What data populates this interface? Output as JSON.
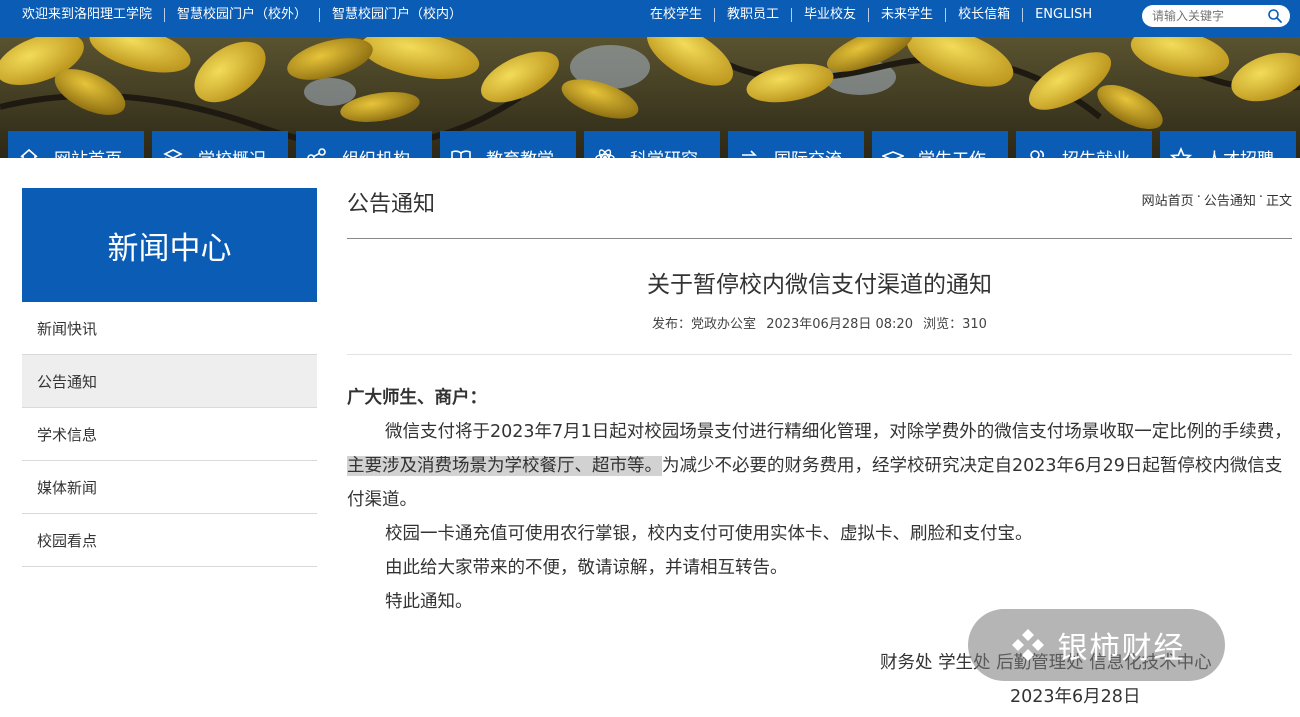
{
  "topbar": {
    "left_links": [
      "欢迎来到洛阳理工学院",
      "智慧校园门户（校外）",
      "智慧校园门户（校内）"
    ],
    "right_links": [
      "在校学生",
      "教职员工",
      "毕业校友",
      "未来学生",
      "校长信箱",
      "ENGLISH"
    ],
    "search_placeholder": "请输入关键字"
  },
  "nav": [
    {
      "label": "网站首页",
      "icon": "home-icon"
    },
    {
      "label": "学校概况",
      "icon": "layers-icon"
    },
    {
      "label": "组织机构",
      "icon": "share-icon"
    },
    {
      "label": "教育教学",
      "icon": "book-icon"
    },
    {
      "label": "科学研究",
      "icon": "atom-icon"
    },
    {
      "label": "国际交流",
      "icon": "exchange-icon"
    },
    {
      "label": "学生工作",
      "icon": "graduation-cap-icon"
    },
    {
      "label": "招生就业",
      "icon": "users-icon"
    },
    {
      "label": "人才招聘",
      "icon": "star-icon"
    }
  ],
  "sidebar": {
    "title": "新闻中心",
    "items": [
      "新闻快讯",
      "公告通知",
      "学术信息",
      "媒体新闻",
      "校园看点"
    ],
    "active_index": 1
  },
  "section_title": "公告通知",
  "breadcrumb": {
    "items": [
      "网站首页",
      "公告通知",
      "正文"
    ],
    "separator": "·"
  },
  "article": {
    "title": "关于暂停校内微信支付渠道的通知",
    "meta": {
      "publisher": "发布：党政办公室",
      "datetime": "2023年06月28日 08:20",
      "views": "浏览：310"
    },
    "greeting": "广大师生、商户：",
    "p1_a": "微信支付将于2023年7月1日起对校园场景支付进行精细化管理，对除学费外的微信支付场景收取一定比例的手续费，",
    "p1_highlight": "主要涉及消费场景为学校餐厅、超市等。",
    "p1_b": "为减少不必要的财务费用，经学校研究决定自2023年6月29日起暂停校内微信支付渠道。",
    "p2": "校园一卡通充值可使用农行掌银，校内支付可使用实体卡、虚拟卡、刷脸和支付宝。",
    "p3": "由此给大家带来的不便，敬请谅解，并请相互转告。",
    "p4": "特此通知。",
    "signatories": "财务处 学生处 后勤管理处 信息化技术中心",
    "sign_date": "2023年6月28日"
  },
  "watermark": {
    "text": "银柿财经"
  },
  "colors": {
    "brand_blue": "#0a5cb4",
    "highlight": "#d2d2d2",
    "active_bg": "#eeeeee"
  }
}
